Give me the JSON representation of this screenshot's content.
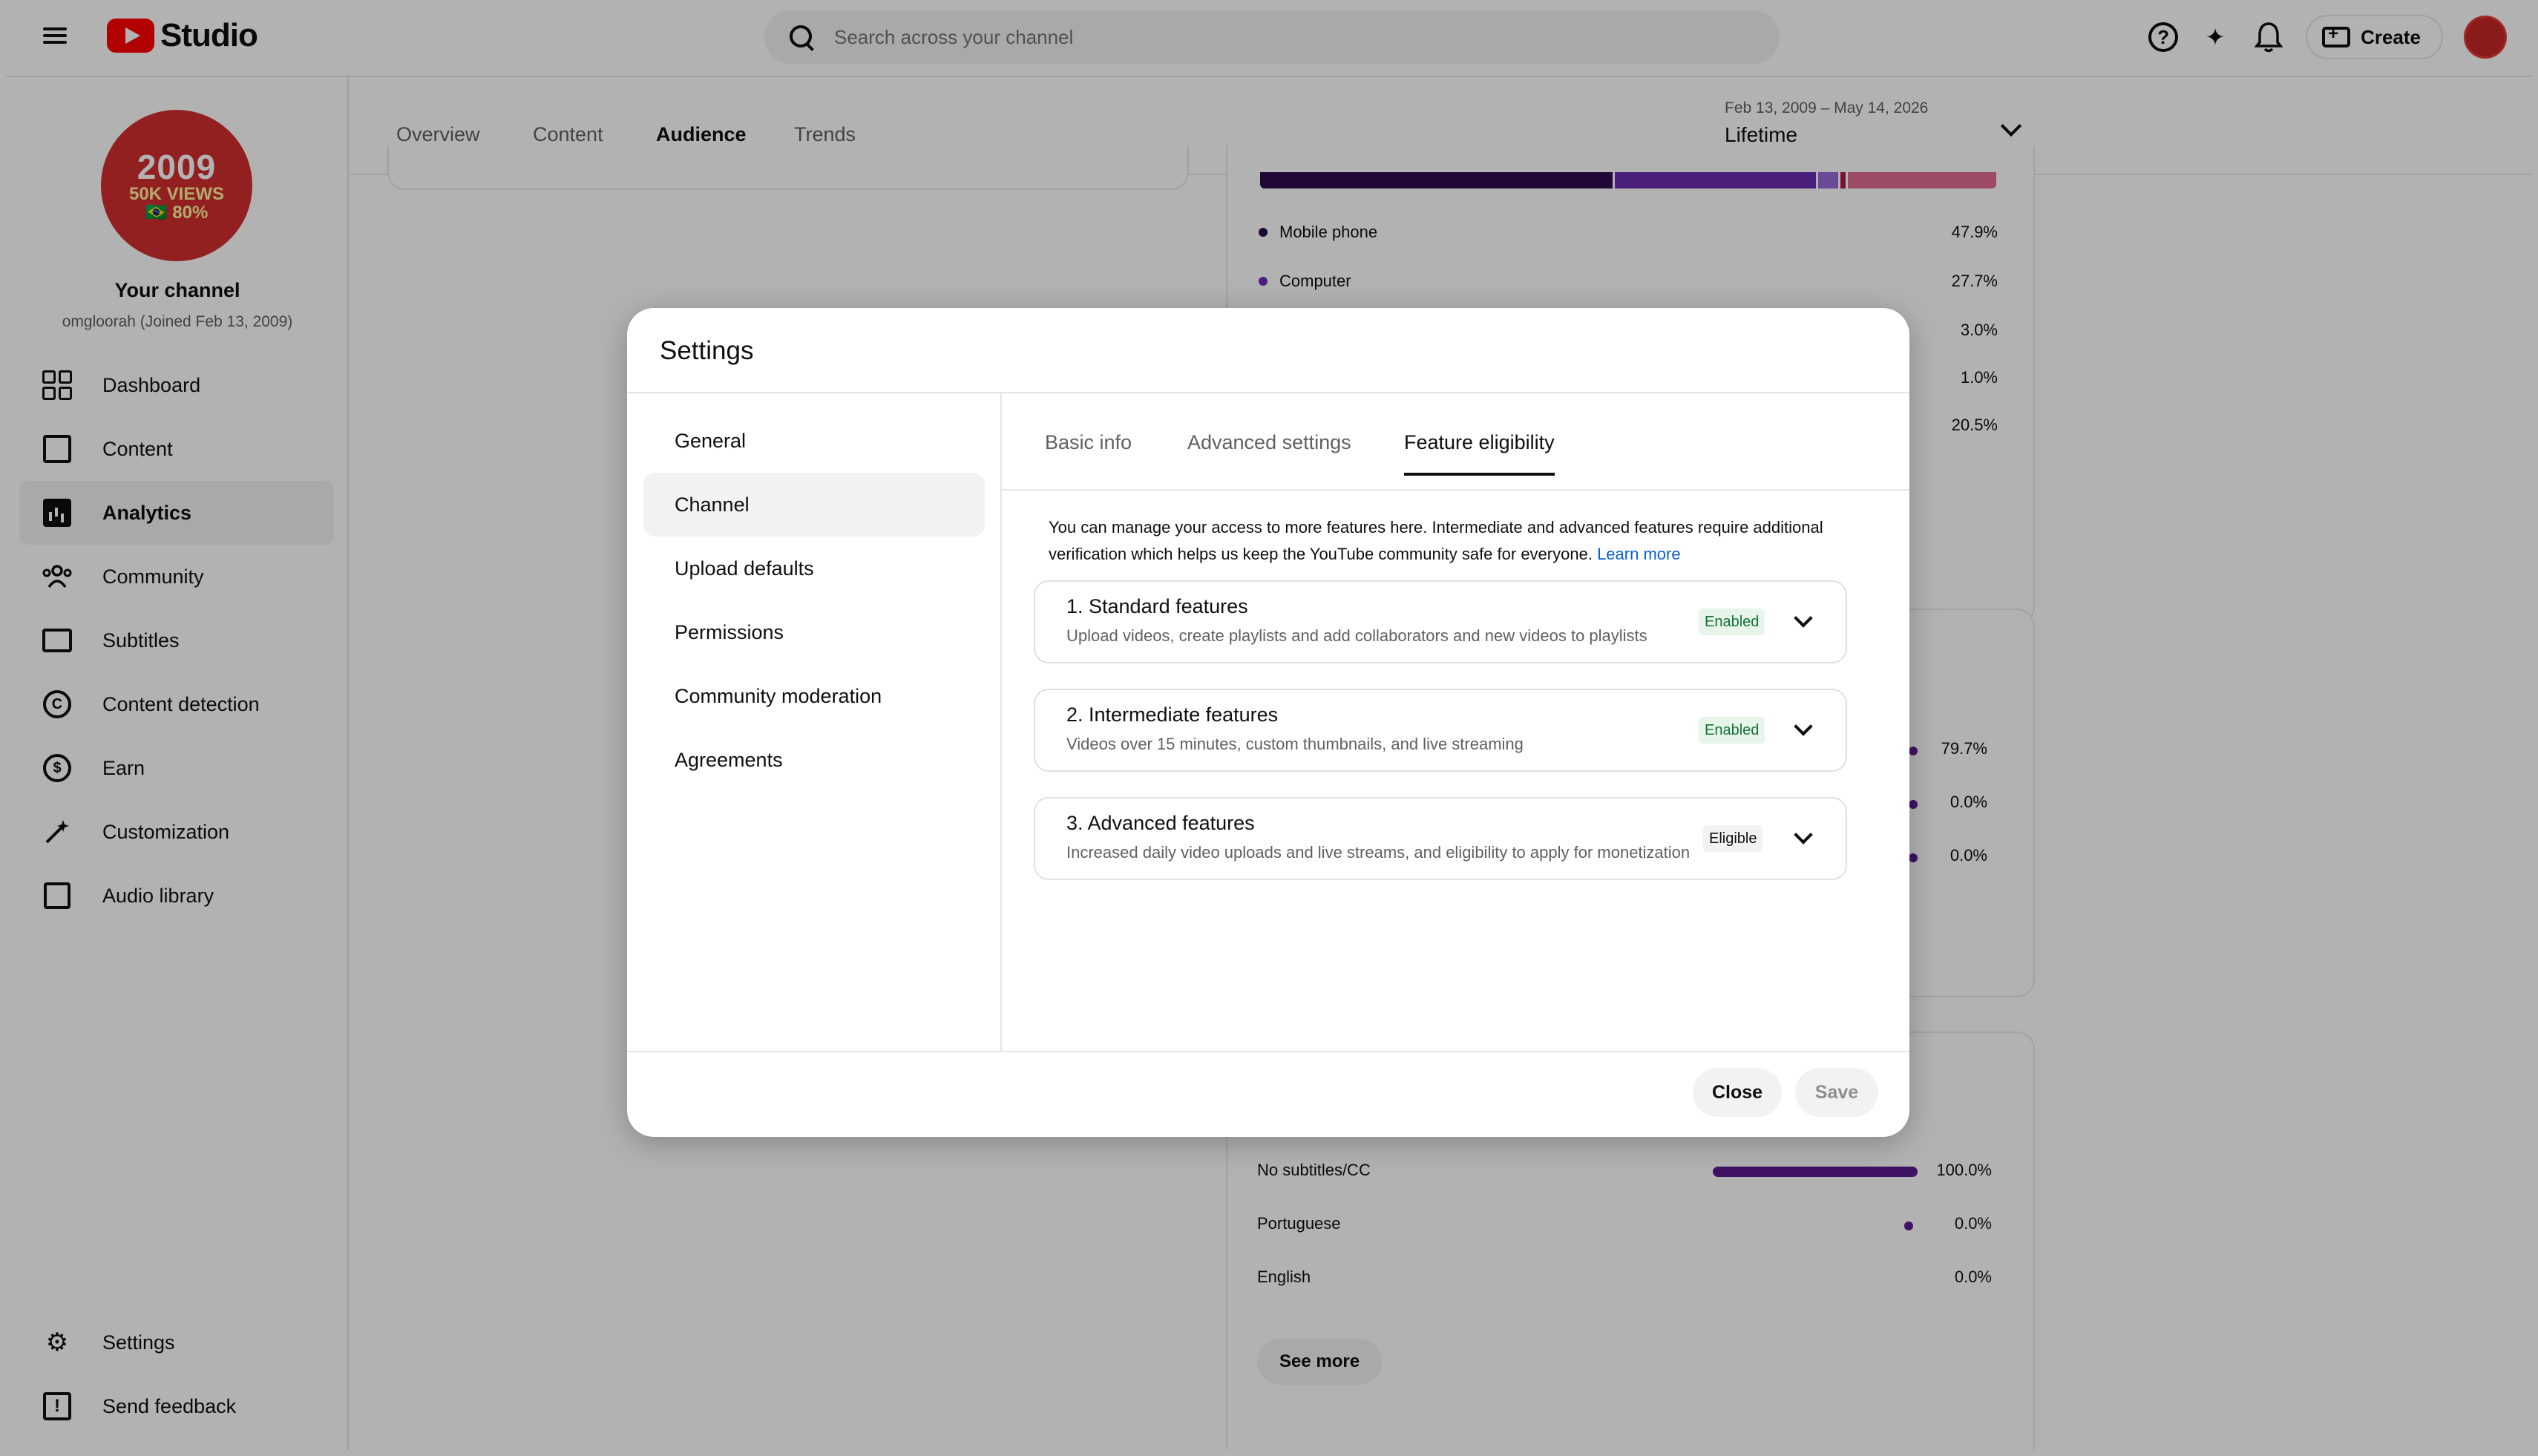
{
  "header": {
    "logo_text": "Studio",
    "search_placeholder": "Search across your channel",
    "create_label": "Create"
  },
  "sidebar": {
    "avatar_lines": [
      "2009",
      "50K VIEWS",
      "🇧🇷 80%"
    ],
    "channel_title": "Your channel",
    "channel_subtitle": "omgloorah (Joined Feb 13, 2009)",
    "items": [
      {
        "label": "Dashboard",
        "icon": "dashboard-icon"
      },
      {
        "label": "Content",
        "icon": "content-icon"
      },
      {
        "label": "Analytics",
        "icon": "analytics-icon",
        "active": true
      },
      {
        "label": "Community",
        "icon": "community-icon"
      },
      {
        "label": "Subtitles",
        "icon": "subtitles-icon"
      },
      {
        "label": "Content detection",
        "icon": "copyright-icon"
      },
      {
        "label": "Earn",
        "icon": "dollar-icon"
      },
      {
        "label": "Customization",
        "icon": "magic-wand-icon"
      },
      {
        "label": "Audio library",
        "icon": "audio-library-icon"
      }
    ],
    "bottom_items": [
      {
        "label": "Settings",
        "icon": "gear-icon"
      },
      {
        "label": "Send feedback",
        "icon": "feedback-icon"
      }
    ]
  },
  "analytics": {
    "tabs": [
      "Overview",
      "Content",
      "Audience",
      "Trends"
    ],
    "active_tab": "Audience",
    "date_range": "Feb 13, 2009 – May 14, 2026",
    "date_label": "Lifetime",
    "device_rows": [
      {
        "label": "Mobile phone",
        "value": "47.9%"
      },
      {
        "label": "Computer",
        "value": "27.7%"
      },
      {
        "label": "",
        "value": "3.0%"
      },
      {
        "label": "",
        "value": "1.0%"
      },
      {
        "label": "",
        "value": "20.5%"
      }
    ],
    "mid_values": [
      "79.7%",
      "0.0%",
      "0.0%"
    ],
    "subtitle_rows": [
      {
        "label": "No subtitles/CC",
        "value": "100.0%"
      },
      {
        "label": "Portuguese",
        "value": "0.0%"
      },
      {
        "label": "English",
        "value": "0.0%"
      }
    ],
    "see_more": "See more"
  },
  "modal": {
    "title": "Settings",
    "nav": [
      "General",
      "Channel",
      "Upload defaults",
      "Permissions",
      "Community moderation",
      "Agreements"
    ],
    "active_nav": "Channel",
    "tabs": [
      "Basic info",
      "Advanced settings",
      "Feature eligibility"
    ],
    "active_tab": "Feature eligibility",
    "intro": "You can manage your access to more features here. Intermediate and advanced features require additional verification which helps us keep the YouTube community safe for everyone.",
    "learn_more": "Learn more",
    "features": [
      {
        "title": "1. Standard features",
        "desc": "Upload videos, create playlists and add collaborators and new videos to playlists",
        "status": "Enabled"
      },
      {
        "title": "2. Intermediate features",
        "desc": "Videos over 15 minutes, custom thumbnails, and live streaming",
        "status": "Enabled"
      },
      {
        "title": "3. Advanced features",
        "desc": "Increased daily video uploads and live streams, and eligibility to apply for monetization",
        "status": "Eligible"
      }
    ],
    "close_label": "Close",
    "save_label": "Save"
  }
}
